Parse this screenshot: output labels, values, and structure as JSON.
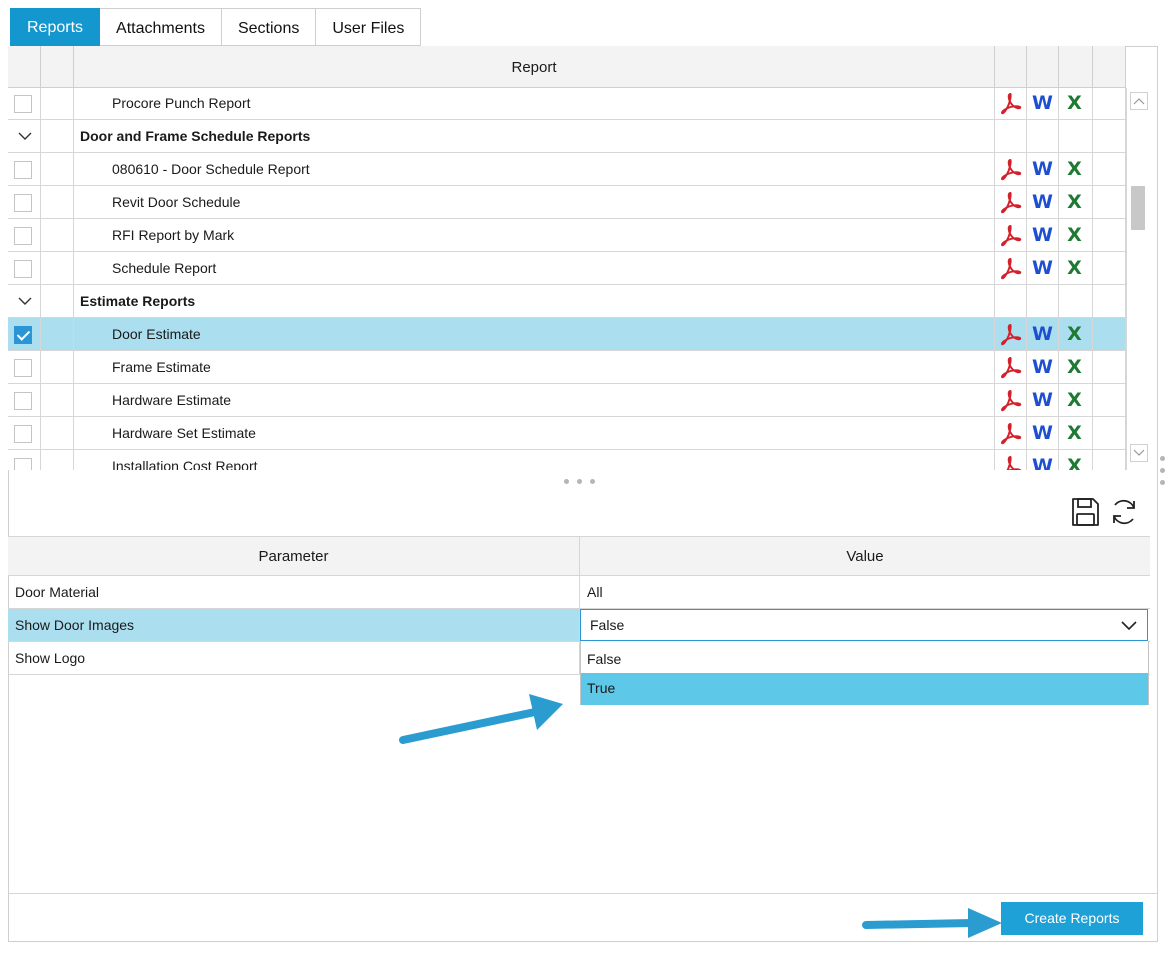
{
  "tabs": [
    {
      "label": "Reports",
      "active": true
    },
    {
      "label": "Attachments",
      "active": false
    },
    {
      "label": "Sections",
      "active": false
    },
    {
      "label": "User Files",
      "active": false
    }
  ],
  "report_grid": {
    "header": "Report",
    "rows": [
      {
        "type": "item",
        "label": "Procore Punch Report",
        "checked": false
      },
      {
        "type": "group",
        "label": "Door and Frame Schedule Reports",
        "expanded": true
      },
      {
        "type": "item",
        "label": "080610 - Door Schedule Report",
        "checked": false
      },
      {
        "type": "item",
        "label": "Revit Door Schedule",
        "checked": false
      },
      {
        "type": "item",
        "label": "RFI Report by Mark",
        "checked": false
      },
      {
        "type": "item",
        "label": "Schedule Report",
        "checked": false
      },
      {
        "type": "group",
        "label": "Estimate Reports",
        "expanded": true
      },
      {
        "type": "item",
        "label": "Door Estimate",
        "checked": true
      },
      {
        "type": "item",
        "label": "Frame Estimate",
        "checked": false
      },
      {
        "type": "item",
        "label": "Hardware Estimate",
        "checked": false
      },
      {
        "type": "item",
        "label": "Hardware Set Estimate",
        "checked": false
      },
      {
        "type": "item",
        "label": "Installation Cost Report",
        "checked": false
      }
    ],
    "export_icons": {
      "word_glyph": "W",
      "excel_glyph": "X"
    }
  },
  "toolbar": {
    "save_icon": "save-icon",
    "refresh_icon": "refresh-icon"
  },
  "parameters": {
    "header_param": "Parameter",
    "header_value": "Value",
    "rows": [
      {
        "name": "Door Material",
        "value": "All"
      },
      {
        "name": "Show Door Images",
        "value": "False"
      },
      {
        "name": "Show Logo",
        "value": ""
      }
    ],
    "dropdown_options": [
      "False",
      "True"
    ],
    "highlighted_option": "True"
  },
  "create_button": "Create Reports",
  "colors": {
    "accent": "#1496cf",
    "selected_row": "#abdff0",
    "dropdown_highlight": "#5dc8e8",
    "pdf_red": "#d4202a",
    "word_blue": "#1f4fd1",
    "excel_green": "#1e7a32",
    "arrow": "#2a9ccf"
  }
}
